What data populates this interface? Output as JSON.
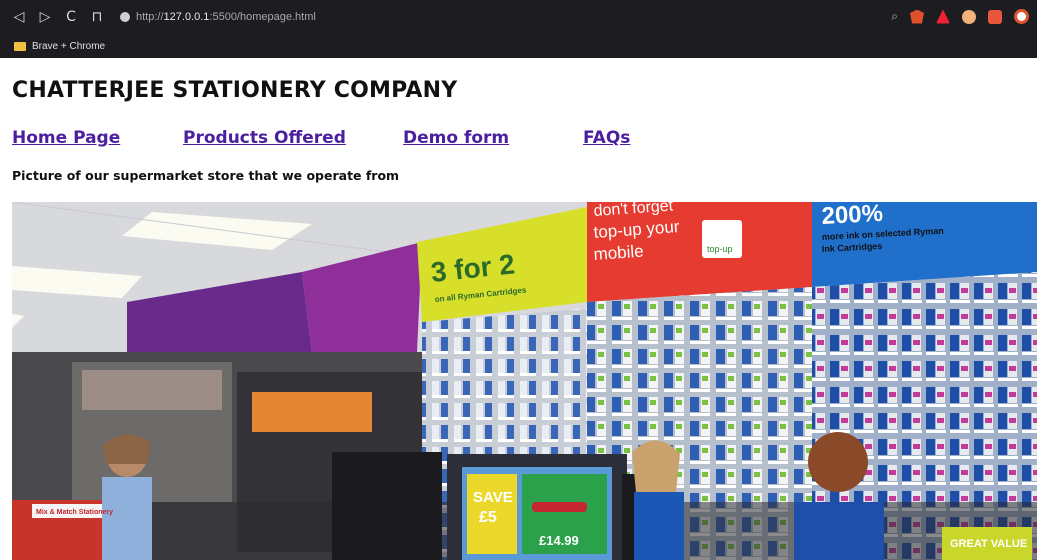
{
  "browser": {
    "url_prefix": "http://",
    "url_host": "127.0.0.1",
    "url_path": ":5500/homepage.html",
    "bookmark_folder": "Brave + Chrome"
  },
  "page": {
    "title": "CHATTERJEE STATIONERY COMPANY",
    "nav": [
      {
        "label": "Home Page"
      },
      {
        "label": "Products Offered"
      },
      {
        "label": "Demo form"
      },
      {
        "label": "FAQs"
      }
    ],
    "caption": "Picture of our supermarket store that we operate from"
  },
  "photo": {
    "signs": {
      "three_for_two": "3 for 2",
      "three_for_two_sub": "on all Ryman Cartridges",
      "topup_line1": "don't forget",
      "topup_line2": "top-up your",
      "topup_line3": "mobile",
      "topup_badge": "top-up",
      "ink_big": "200%",
      "ink_line1": "more ink on selected Ryman",
      "ink_line2": "Ink Cartridges",
      "save": "SAVE",
      "save_amount": "£5",
      "price": "£14.99",
      "mix_match": "Mix & Match Stationery",
      "great_value": "GREAT VALUE"
    }
  },
  "colors": {
    "link": "#4b1f9e",
    "chrome_bg": "#1d1d21"
  }
}
